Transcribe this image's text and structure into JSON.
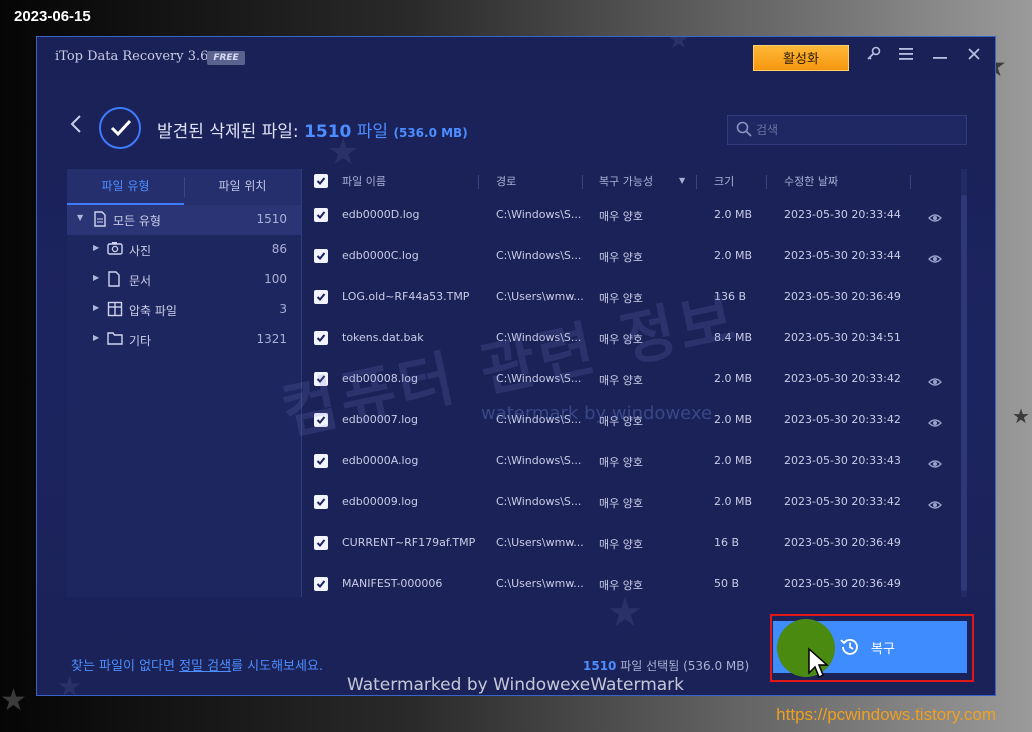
{
  "overlay": {
    "date": "2023-06-15",
    "site_url": "https://pcwindows.tistory.com",
    "watermark_korean": "컴퓨터 관련 정보",
    "watermark_small": "watermark by windowexe",
    "watermark_bottom": "Watermarked by WindowexeWatermark"
  },
  "titlebar": {
    "app_title": "iTop Data Recovery 3.6",
    "edition_badge": "FREE",
    "activate_label": "활성화",
    "icons": [
      "key-icon",
      "menu-icon",
      "minimize-icon",
      "close-icon"
    ]
  },
  "header": {
    "title_prefix": "발견된 삭제된 파일:",
    "count": "1510",
    "count_unit": "파일",
    "total_size": "(536.0 MB)",
    "search_placeholder": "검색"
  },
  "sidebar": {
    "tabs": [
      {
        "label": "파일 유형",
        "active": true
      },
      {
        "label": "파일 위치",
        "active": false
      }
    ],
    "tree": [
      {
        "label": "모든 유형",
        "count": "1510",
        "icon": "document-icon",
        "selected": true
      },
      {
        "label": "사진",
        "count": "86",
        "icon": "camera-icon",
        "selected": false
      },
      {
        "label": "문서",
        "count": "100",
        "icon": "file-icon",
        "selected": false
      },
      {
        "label": "압축 파일",
        "count": "3",
        "icon": "archive-icon",
        "selected": false
      },
      {
        "label": "기타",
        "count": "1321",
        "icon": "folder-icon",
        "selected": false
      }
    ]
  },
  "table": {
    "columns": [
      "파일 이름",
      "경로",
      "복구 가능성",
      "크기",
      "수정한 날짜"
    ],
    "rows": [
      {
        "name": "edb0000D.log",
        "path": "C:\\Windows\\S...",
        "chance": "매우 양호",
        "size": "2.0 MB",
        "date": "2023-05-30 20:33:44",
        "preview": true
      },
      {
        "name": "edb0000C.log",
        "path": "C:\\Windows\\S...",
        "chance": "매우 양호",
        "size": "2.0 MB",
        "date": "2023-05-30 20:33:44",
        "preview": true
      },
      {
        "name": "LOG.old~RF44a53.TMP",
        "path": "C:\\Users\\wmw...",
        "chance": "매우 양호",
        "size": "136 B",
        "date": "2023-05-30 20:36:49",
        "preview": false
      },
      {
        "name": "tokens.dat.bak",
        "path": "C:\\Windows\\S...",
        "chance": "매우 양호",
        "size": "8.4 MB",
        "date": "2023-05-30 20:34:51",
        "preview": false
      },
      {
        "name": "edb00008.log",
        "path": "C:\\Windows\\S...",
        "chance": "매우 양호",
        "size": "2.0 MB",
        "date": "2023-05-30 20:33:42",
        "preview": true
      },
      {
        "name": "edb00007.log",
        "path": "C:\\Windows\\S...",
        "chance": "매우 양호",
        "size": "2.0 MB",
        "date": "2023-05-30 20:33:42",
        "preview": true
      },
      {
        "name": "edb0000A.log",
        "path": "C:\\Windows\\S...",
        "chance": "매우 양호",
        "size": "2.0 MB",
        "date": "2023-05-30 20:33:43",
        "preview": true
      },
      {
        "name": "edb00009.log",
        "path": "C:\\Windows\\S...",
        "chance": "매우 양호",
        "size": "2.0 MB",
        "date": "2023-05-30 20:33:42",
        "preview": true
      },
      {
        "name": "CURRENT~RF179af.TMP",
        "path": "C:\\Users\\wmw...",
        "chance": "매우 양호",
        "size": "16 B",
        "date": "2023-05-30 20:36:49",
        "preview": false
      },
      {
        "name": "MANIFEST-000006",
        "path": "C:\\Users\\wmw...",
        "chance": "매우 양호",
        "size": "50 B",
        "date": "2023-05-30 20:36:49",
        "preview": false
      }
    ]
  },
  "footer": {
    "hint_before": "찾는 파일이 없다면 ",
    "hint_link": "정밀 검색",
    "hint_after": "를 시도해보세요.",
    "selected_count": "1510",
    "selected_text": "파일 선택됨 (536.0 MB)",
    "recover_label": "복구"
  },
  "colors": {
    "accent": "#3f8cff",
    "activate": "#f4a21a",
    "highlight_frame": "#e01818"
  }
}
